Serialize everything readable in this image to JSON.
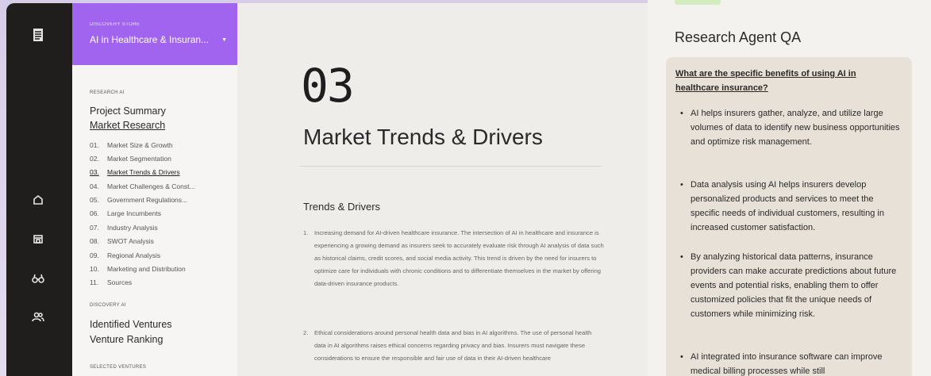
{
  "store": {
    "label": "DISCOVERY STORE",
    "selected": "AI in Healthcare & Insuran..."
  },
  "sidebar": {
    "research_label": "RESEARCH AI",
    "project_summary": "Project Summary",
    "market_research": "Market Research",
    "items": [
      {
        "num": "01.",
        "label": "Market Size & Growth"
      },
      {
        "num": "02.",
        "label": "Market Segmentation"
      },
      {
        "num": "03.",
        "label": "Market Trends & Drivers"
      },
      {
        "num": "04.",
        "label": "Market Challenges & Const..."
      },
      {
        "num": "05.",
        "label": "Government Regulations..."
      },
      {
        "num": "06.",
        "label": "Large Incumbents"
      },
      {
        "num": "07.",
        "label": "Industry Analysis"
      },
      {
        "num": "08.",
        "label": "SWOT Analysis"
      },
      {
        "num": "09.",
        "label": "Regional Analysis"
      },
      {
        "num": "10.",
        "label": "Marketing and Distribution"
      },
      {
        "num": "11.",
        "label": "Sources"
      }
    ],
    "discovery_label": "DISCOVERY AI",
    "identified_ventures": "Identified Ventures",
    "venture_ranking": "Venture Ranking",
    "selected_label": "SELECTED VENTURES"
  },
  "main": {
    "number": "03",
    "title": "Market Trends & Drivers",
    "subtitle": "Trends & Drivers",
    "paragraphs": [
      {
        "num": "1.",
        "text": "Increasing demand for AI-driven healthcare insurance. The intersection of AI in healthcare and insurance is experiencing a growing demand as insurers seek to accurately evaluate risk through AI analysis of data such as historical claims, credit scores, and social media activity. This trend is driven by the need for insurers to optimize care for individuals with chronic conditions and to differentiate themselves in the market by offering data-driven insurance products."
      },
      {
        "num": "2.",
        "text": "Ethical considerations around personal health data and bias in AI algorithms. The use of personal health data in AI algorithms raises ethical concerns regarding privacy and bias. Insurers must navigate these considerations to ensure the responsible and fair use of data in their AI-driven healthcare"
      }
    ]
  },
  "qa": {
    "title": "Research Agent QA",
    "question": "What are the specific benefits of using AI in healthcare insurance?",
    "bullets": [
      "AI helps insurers gather, analyze, and utilize large volumes of data to identify new business opportunities and optimize risk management.",
      "Data analysis using AI helps insurers develop personalized products and services to meet the specific needs of individual customers, resulting in increased customer satisfaction.",
      "By analyzing historical data patterns, insurance providers can make accurate predictions about future events and potential risks, enabling them to offer customized policies that fit the unique needs of customers while minimizing risk.",
      "AI integrated into insurance software can improve medical billing processes while still"
    ]
  },
  "icons": [
    "document-icon",
    "home-icon",
    "store-icon",
    "binoculars-icon",
    "users-icon",
    "chevron-down-icon"
  ],
  "colors": {
    "accent": "#a064ef",
    "rail": "#1f1e1d",
    "tag": "#d3ecc0"
  }
}
